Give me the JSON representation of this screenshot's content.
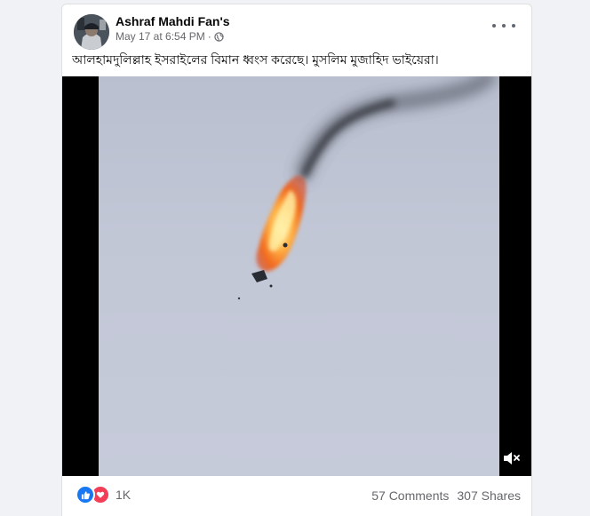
{
  "post": {
    "author": "Ashraf Mahdi Fan's",
    "timestamp": "May 17 at 6:54 PM",
    "separator": "·",
    "privacy_icon": "globe-icon",
    "menu_icon": "more-options-icon",
    "caption": "আলহামদুলিল্লাহ ইসরাইলের বিমান ধ্বংস করেছে। মুসলিম মুজাহিদ ভাইয়েরা।"
  },
  "video": {
    "description_icons": [
      "fire",
      "smoke"
    ],
    "mute_icon": "speaker-muted-icon"
  },
  "footer": {
    "reaction_icons": [
      "like-icon",
      "love-icon"
    ],
    "reaction_count": "1K",
    "comments": "57 Comments",
    "shares": "307 Shares"
  },
  "colors": {
    "page_bg": "#f0f2f5",
    "like": "#1877f2",
    "love": "#f33e58",
    "secondary_text": "#65676b"
  }
}
